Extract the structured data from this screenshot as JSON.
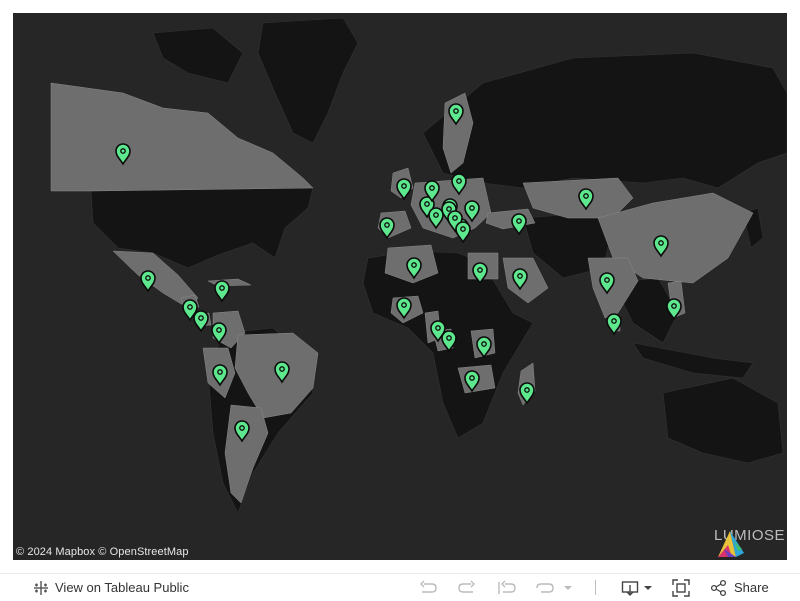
{
  "map": {
    "attribution": "© 2024 Mapbox  © OpenStreetMap",
    "logo_text": "LUMIOSE",
    "colors": {
      "ocean": "#262626",
      "land_highlight": "#6e6e6e",
      "land_dark": "#141414",
      "marker": "#5de88e"
    },
    "markers": [
      {
        "name": "Canada"
      },
      {
        "name": "Mexico"
      },
      {
        "name": "Cuba"
      },
      {
        "name": "Guatemala"
      },
      {
        "name": "Costa Rica"
      },
      {
        "name": "Colombia"
      },
      {
        "name": "Peru"
      },
      {
        "name": "Brazil"
      },
      {
        "name": "Argentina"
      },
      {
        "name": "United Kingdom"
      },
      {
        "name": "Spain"
      },
      {
        "name": "France"
      },
      {
        "name": "Netherlands"
      },
      {
        "name": "Germany"
      },
      {
        "name": "Switzerland"
      },
      {
        "name": "Italy"
      },
      {
        "name": "Poland"
      },
      {
        "name": "Austria"
      },
      {
        "name": "Hungary"
      },
      {
        "name": "Serbia"
      },
      {
        "name": "Greece"
      },
      {
        "name": "Sweden"
      },
      {
        "name": "Turkey"
      },
      {
        "name": "Kazakhstan"
      },
      {
        "name": "Algeria"
      },
      {
        "name": "Egypt"
      },
      {
        "name": "Saudi Arabia"
      },
      {
        "name": "Nigeria"
      },
      {
        "name": "Cameroon"
      },
      {
        "name": "Gabon"
      },
      {
        "name": "Kenya"
      },
      {
        "name": "Zambia"
      },
      {
        "name": "Madagascar"
      },
      {
        "name": "India"
      },
      {
        "name": "Sri Lanka"
      },
      {
        "name": "China"
      },
      {
        "name": "Philippines"
      }
    ]
  },
  "toolbar": {
    "view_label": "View on Tableau Public",
    "share_label": "Share"
  }
}
